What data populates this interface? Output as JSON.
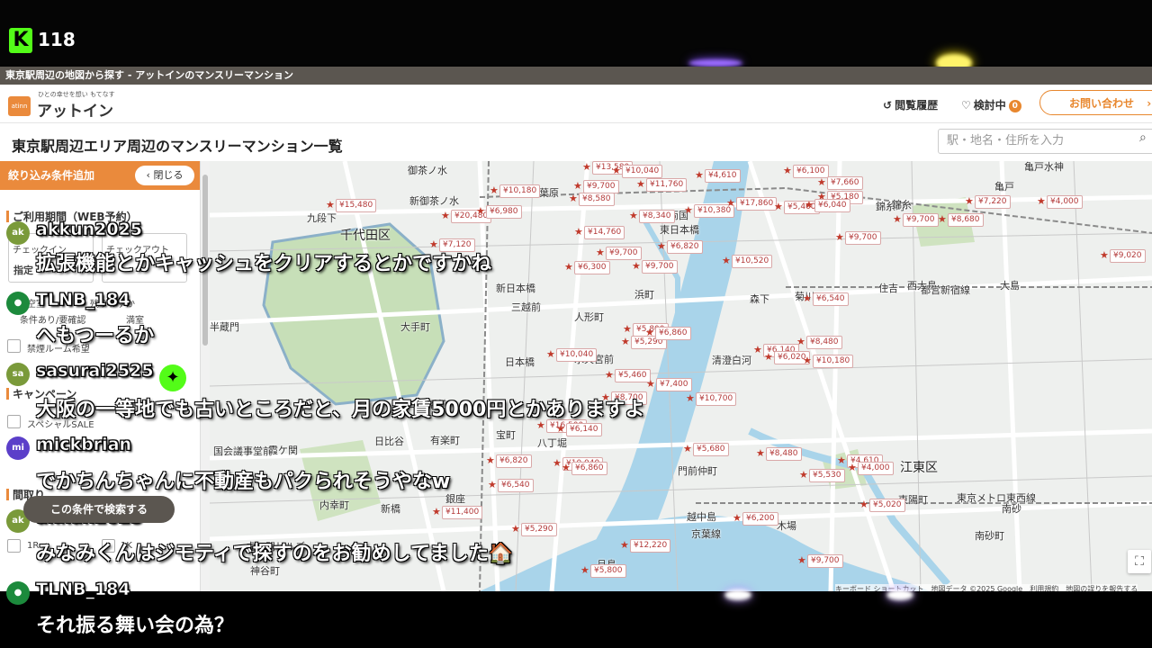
{
  "stream": {
    "viewer_count": "118",
    "logo": "K"
  },
  "window": {
    "title": "東京駅周辺の地図から探す - アットインのマンスリーマンション"
  },
  "header": {
    "logo_mark": "atinn",
    "logo_tagline": "ひとの幸せを想い もてなす",
    "logo_text": "アットイン",
    "history_label": "閲覧履歴",
    "favorites_label": "検討中",
    "favorites_count": "0",
    "contact_label": "お問い合わせ"
  },
  "page": {
    "title": "東京駅周辺エリア周辺のマンスリーマンション一覧",
    "search_placeholder": "駅・地名・住所を入力"
  },
  "sidebar": {
    "header": "絞り込み条件追加",
    "close_label": "閉じる",
    "section_period": "ご利用期間（WEB予約）",
    "checkin": "チェックイン",
    "checkout": "チェックアウト",
    "specify": "指定",
    "vacancy_partial": "空室",
    "vacancy_small": "残りわずか",
    "conditional": "条件あり/要確認",
    "full": "満室",
    "no_smoking": "禁煙ルーム希望",
    "section_campaign": "キャンペーン",
    "special_sale": "スペシャルSALE",
    "section_layout": "間取り",
    "layout_1r": "1R",
    "layout_1k": "1K",
    "search_button": "この条件で検索する"
  },
  "map": {
    "areas": [
      {
        "name": "千代田区",
        "big": true
      },
      {
        "name": "江東区",
        "big": true
      },
      {
        "name": "御茶ノ水"
      },
      {
        "name": "新御茶ノ水"
      },
      {
        "name": "秋葉原"
      },
      {
        "name": "九段下"
      },
      {
        "name": "両国"
      },
      {
        "name": "錦糸町"
      },
      {
        "name": "亀戸"
      },
      {
        "name": "亀戸水神"
      },
      {
        "name": "東日本橋"
      },
      {
        "name": "新日本橋"
      },
      {
        "name": "三越前"
      },
      {
        "name": "人形町"
      },
      {
        "name": "浜町"
      },
      {
        "name": "森下"
      },
      {
        "name": "菊川"
      },
      {
        "name": "住吉"
      },
      {
        "name": "西大島"
      },
      {
        "name": "大島"
      },
      {
        "name": "半蔵門"
      },
      {
        "name": "大手町"
      },
      {
        "name": "日本橋"
      },
      {
        "name": "水天宮前"
      },
      {
        "name": "清澄白河"
      },
      {
        "name": "二重橋前"
      },
      {
        "name": "有楽町"
      },
      {
        "name": "日比谷"
      },
      {
        "name": "宝町"
      },
      {
        "name": "八丁堀"
      },
      {
        "name": "国会議事堂前"
      },
      {
        "name": "霞ケ関"
      },
      {
        "name": "銀座"
      },
      {
        "name": "門前仲町"
      },
      {
        "name": "内幸町"
      },
      {
        "name": "新橋"
      },
      {
        "name": "虎ノ門ヒルズ"
      },
      {
        "name": "神谷町"
      },
      {
        "name": "越中島"
      },
      {
        "name": "月島"
      },
      {
        "name": "木場"
      },
      {
        "name": "東陽町"
      },
      {
        "name": "南砂町"
      },
      {
        "name": "南砂"
      },
      {
        "name": "都営新宿線"
      },
      {
        "name": "東京メトロ東西線"
      },
      {
        "name": "京葉線"
      },
      {
        "name": "錦糸"
      }
    ],
    "prices": [
      "¥13,580",
      "¥10,040",
      "¥4,610",
      "¥6,100",
      "¥15,480",
      "¥10,180",
      "¥9,700",
      "¥11,760",
      "¥7,660",
      "¥5,180",
      "¥20,480",
      "¥6,980",
      "¥8,580",
      "¥8,340",
      "¥10,380",
      "¥17,860",
      "¥5,460",
      "¥6,040",
      "¥7,220",
      "¥4,000",
      "¥9,700",
      "¥8,680",
      "¥14,760",
      "¥9,700",
      "¥7,120",
      "¥6,820",
      "¥9,700",
      "¥6,300",
      "¥9,700",
      "¥10,520",
      "¥9,020",
      "¥6,540",
      "¥5,800",
      "¥5,290",
      "¥6,860",
      "¥8,480",
      "¥10,040",
      "¥6,140",
      "¥6,020",
      "¥10,180",
      "¥5,460",
      "¥7,400",
      "¥10,700",
      "¥8,700",
      "¥16,500",
      "¥6,140",
      "¥5,680",
      "¥8,480",
      "¥4,610",
      "¥4,000",
      "¥6,820",
      "¥10,040",
      "¥6,860",
      "¥5,530",
      "¥6,540",
      "¥5,020",
      "¥11,400",
      "¥5,290",
      "¥6,200",
      "¥12,220",
      "¥5,800",
      "¥9,700"
    ],
    "credit": "キーボード ショートカット　地図データ ©2025 Google　利用規約　地図の誤りを報告する"
  },
  "chat": [
    {
      "user": "akkun2025",
      "initials": "ak",
      "avatar_color": "#7a9a3a",
      "message": "拡張機能とかキャッシュをクリアするとかですかね"
    },
    {
      "user": "TLNB_184",
      "initials": "",
      "avatar_color": "#1c8a3c",
      "message": "へもつーるか"
    },
    {
      "user": "sasurai2525",
      "initials": "sa",
      "avatar_color": "#7a9a3a",
      "message": "大阪の一等地でも古いところだと、月の家賃5000円とかありますよ"
    },
    {
      "user": "mickbrian",
      "initials": "mi",
      "avatar_color": "#5b3fc9",
      "message": "でかちんちゃんに不動産もパクられそうやなw"
    },
    {
      "user": "akkun2025",
      "initials": "ak",
      "avatar_color": "#7a9a3a",
      "message": "みなみくんはジモティで探すのをお勧めしてました🏠"
    },
    {
      "user": "TLNB_184",
      "initials": "",
      "avatar_color": "#1c8a3c",
      "message": "それ振る舞い会の為？"
    }
  ],
  "colors": {
    "accent": "#ea8a3c",
    "kick_green": "#53fc18",
    "price_red": "#b33a3a",
    "water": "#a9d4ea"
  }
}
